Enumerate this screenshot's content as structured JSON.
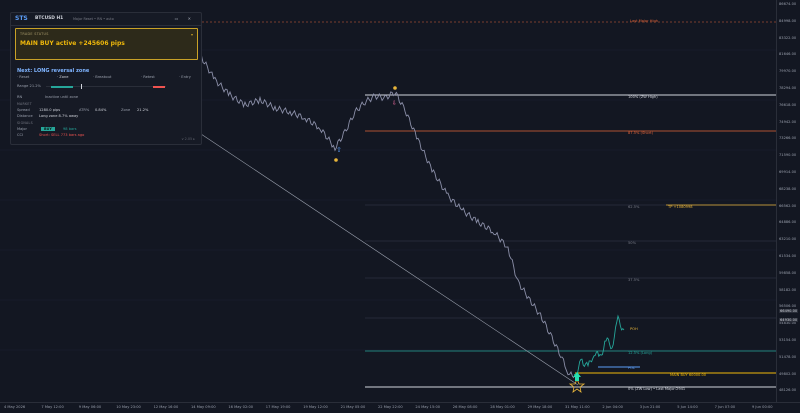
{
  "panel": {
    "brand": "STS",
    "symbol": "BTCUSD H1",
    "subline": "Major Reset • RN • auto",
    "trade_status_label": "TRADE STATUS",
    "trade_status_value": "MAIN BUY active +245606 pips",
    "next_title": "Next: LONG reversal zone",
    "steps": [
      "Reset",
      "Zone",
      "Breakout",
      "Retest",
      "Entry"
    ],
    "range_label": "Range 21.2%",
    "rn_label": "RN",
    "rn_value": "Inactive until zone",
    "market_head": "MARKET",
    "spread_label": "Spread",
    "spread_value": "1280.0 pips",
    "atr_label": "ATR%",
    "atr_value": "0.84%",
    "zone_label": "Zone",
    "zone_value": "21.2%",
    "distance_label": "Distance",
    "distance_value": "Long zone 8.7% away",
    "signals_head": "SIGNALS",
    "major_label": "Major",
    "major_badge": "BUY",
    "major_age": "98 bars",
    "cci_label": "CCI",
    "cci_value": "Short: SELL 773 bars ago",
    "footer": "v 2.05 ▸"
  },
  "levels": {
    "last_major_high": "Last Major High",
    "zw_high": "100% (ZW High)",
    "lvl_875": "87.5% (Short)",
    "tp": "TP +1080998",
    "lvl_625": "62.5%",
    "lvl_50": "50%",
    "lvl_375": "37.5%",
    "poh": "POH",
    "lvl_125": "12.5% (Long)",
    "pol": "POL",
    "main_buy": "MAIN BUY 60000.00",
    "zw_low": "0% (ZW Low) • Last Major:2941"
  },
  "price_axis": [
    "86674.00",
    "84998.00",
    "83322.00",
    "81646.00",
    "79970.00",
    "78294.00",
    "76618.00",
    "74942.00",
    "73266.00",
    "71590.00",
    "69914.00",
    "68238.00",
    "66562.00",
    "64886.00",
    "63210.00",
    "61534.00",
    "59858.00",
    "58182.00",
    "56506.00",
    "54830.00",
    "53154.00",
    "51478.00",
    "49802.00",
    "48126.00"
  ],
  "price_highlight": [
    "66490.00",
    "64930.00"
  ],
  "time_axis": [
    "4 May 2026",
    "7 May 12:00",
    "9 May 06:00",
    "10 May 23:00",
    "12 May 16:00",
    "14 May 09:00",
    "16 May 02:00",
    "17 May 19:00",
    "19 May 12:00",
    "21 May 05:00",
    "22 May 22:00",
    "24 May 15:00",
    "26 May 08:00",
    "28 May 01:00",
    "29 May 18:00",
    "31 May 11:00",
    "2 Jun 04:00",
    "3 Jun 21:00",
    "5 Jun 14:00",
    "7 Jun 07:00",
    "9 Jun 00:00"
  ],
  "colors": {
    "background": "#131722",
    "candle": "#8b8fa8",
    "white_level": "#d1d4dc",
    "short_level": "#e0643a",
    "tp_level": "#e8b53a",
    "teal_level": "#26a69a",
    "blue_level": "#5b9cf5",
    "accent_gold": "#f0b90b"
  },
  "icons": {
    "up_arrow": "arrow-up-icon",
    "down_arrow": "arrow-down-icon",
    "panel_controls": "window-controls-icon"
  }
}
